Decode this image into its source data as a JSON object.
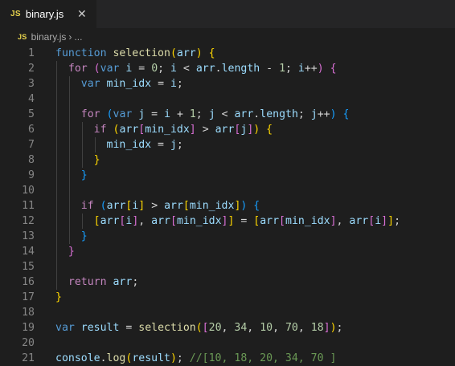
{
  "tab": {
    "icon": "JS",
    "filename": "binary.js",
    "close": "✕"
  },
  "breadcrumb": {
    "icon": "JS",
    "file": "binary.js",
    "separator": "›",
    "more": "..."
  },
  "lines": [
    {
      "n": "1",
      "indent": 0,
      "tokens": [
        [
          "function",
          "kw"
        ],
        [
          " ",
          "op"
        ],
        [
          "selection",
          "fn"
        ],
        [
          "(",
          "b1"
        ],
        [
          "arr",
          "var"
        ],
        [
          ")",
          "b1"
        ],
        [
          " ",
          "op"
        ],
        [
          "{",
          "b1"
        ]
      ]
    },
    {
      "n": "2",
      "indent": 1,
      "tokens": [
        [
          "for",
          "kwc"
        ],
        [
          " ",
          "op"
        ],
        [
          "(",
          "b2"
        ],
        [
          "var",
          "kw"
        ],
        [
          " ",
          "op"
        ],
        [
          "i",
          "var"
        ],
        [
          " = ",
          "op"
        ],
        [
          "0",
          "num"
        ],
        [
          "; ",
          "op"
        ],
        [
          "i",
          "var"
        ],
        [
          " < ",
          "op"
        ],
        [
          "arr",
          "var"
        ],
        [
          ".",
          "op"
        ],
        [
          "length",
          "var"
        ],
        [
          " - ",
          "op"
        ],
        [
          "1",
          "num"
        ],
        [
          "; ",
          "op"
        ],
        [
          "i",
          "var"
        ],
        [
          "++",
          "op"
        ],
        [
          ")",
          "b2"
        ],
        [
          " ",
          "op"
        ],
        [
          "{",
          "b2"
        ]
      ]
    },
    {
      "n": "3",
      "indent": 2,
      "tokens": [
        [
          "var",
          "kw"
        ],
        [
          " ",
          "op"
        ],
        [
          "min_idx",
          "var"
        ],
        [
          " = ",
          "op"
        ],
        [
          "i",
          "var"
        ],
        [
          ";",
          "op"
        ]
      ]
    },
    {
      "n": "4",
      "indent": 2,
      "tokens": []
    },
    {
      "n": "5",
      "indent": 2,
      "tokens": [
        [
          "for",
          "kwc"
        ],
        [
          " ",
          "op"
        ],
        [
          "(",
          "b3"
        ],
        [
          "var",
          "kw"
        ],
        [
          " ",
          "op"
        ],
        [
          "j",
          "var"
        ],
        [
          " = ",
          "op"
        ],
        [
          "i",
          "var"
        ],
        [
          " + ",
          "op"
        ],
        [
          "1",
          "num"
        ],
        [
          "; ",
          "op"
        ],
        [
          "j",
          "var"
        ],
        [
          " < ",
          "op"
        ],
        [
          "arr",
          "var"
        ],
        [
          ".",
          "op"
        ],
        [
          "length",
          "var"
        ],
        [
          "; ",
          "op"
        ],
        [
          "j",
          "var"
        ],
        [
          "++",
          "op"
        ],
        [
          ")",
          "b3"
        ],
        [
          " ",
          "op"
        ],
        [
          "{",
          "b3"
        ]
      ]
    },
    {
      "n": "6",
      "indent": 3,
      "tokens": [
        [
          "if",
          "kwc"
        ],
        [
          " ",
          "op"
        ],
        [
          "(",
          "b1"
        ],
        [
          "arr",
          "var"
        ],
        [
          "[",
          "b2"
        ],
        [
          "min_idx",
          "var"
        ],
        [
          "]",
          "b2"
        ],
        [
          " > ",
          "op"
        ],
        [
          "arr",
          "var"
        ],
        [
          "[",
          "b2"
        ],
        [
          "j",
          "var"
        ],
        [
          "]",
          "b2"
        ],
        [
          ")",
          "b1"
        ],
        [
          " ",
          "op"
        ],
        [
          "{",
          "b1"
        ]
      ]
    },
    {
      "n": "7",
      "indent": 4,
      "tokens": [
        [
          "min_idx",
          "var"
        ],
        [
          " = ",
          "op"
        ],
        [
          "j",
          "var"
        ],
        [
          ";",
          "op"
        ]
      ]
    },
    {
      "n": "8",
      "indent": 3,
      "tokens": [
        [
          "}",
          "b1"
        ]
      ]
    },
    {
      "n": "9",
      "indent": 2,
      "tokens": [
        [
          "}",
          "b3"
        ]
      ]
    },
    {
      "n": "10",
      "indent": 2,
      "tokens": []
    },
    {
      "n": "11",
      "indent": 2,
      "tokens": [
        [
          "if",
          "kwc"
        ],
        [
          " ",
          "op"
        ],
        [
          "(",
          "b3"
        ],
        [
          "arr",
          "var"
        ],
        [
          "[",
          "b1"
        ],
        [
          "i",
          "var"
        ],
        [
          "]",
          "b1"
        ],
        [
          " > ",
          "op"
        ],
        [
          "arr",
          "var"
        ],
        [
          "[",
          "b1"
        ],
        [
          "min_idx",
          "var"
        ],
        [
          "]",
          "b1"
        ],
        [
          ")",
          "b3"
        ],
        [
          " ",
          "op"
        ],
        [
          "{",
          "b3"
        ]
      ]
    },
    {
      "n": "12",
      "indent": 3,
      "tokens": [
        [
          "[",
          "b1"
        ],
        [
          "arr",
          "var"
        ],
        [
          "[",
          "b2"
        ],
        [
          "i",
          "var"
        ],
        [
          "]",
          "b2"
        ],
        [
          ", ",
          "op"
        ],
        [
          "arr",
          "var"
        ],
        [
          "[",
          "b2"
        ],
        [
          "min_idx",
          "var"
        ],
        [
          "]",
          "b2"
        ],
        [
          "]",
          "b1"
        ],
        [
          " = ",
          "op"
        ],
        [
          "[",
          "b1"
        ],
        [
          "arr",
          "var"
        ],
        [
          "[",
          "b2"
        ],
        [
          "min_idx",
          "var"
        ],
        [
          "]",
          "b2"
        ],
        [
          ", ",
          "op"
        ],
        [
          "arr",
          "var"
        ],
        [
          "[",
          "b2"
        ],
        [
          "i",
          "var"
        ],
        [
          "]",
          "b2"
        ],
        [
          "]",
          "b1"
        ],
        [
          ";",
          "op"
        ]
      ]
    },
    {
      "n": "13",
      "indent": 2,
      "tokens": [
        [
          "}",
          "b3"
        ]
      ]
    },
    {
      "n": "14",
      "indent": 1,
      "tokens": [
        [
          "}",
          "b2"
        ]
      ]
    },
    {
      "n": "15",
      "indent": 1,
      "tokens": []
    },
    {
      "n": "16",
      "indent": 1,
      "tokens": [
        [
          "return",
          "kwc"
        ],
        [
          " ",
          "op"
        ],
        [
          "arr",
          "var"
        ],
        [
          ";",
          "op"
        ]
      ]
    },
    {
      "n": "17",
      "indent": 0,
      "tokens": [
        [
          "}",
          "b1"
        ]
      ]
    },
    {
      "n": "18",
      "indent": 0,
      "tokens": []
    },
    {
      "n": "19",
      "indent": 0,
      "tokens": [
        [
          "var",
          "kw"
        ],
        [
          " ",
          "op"
        ],
        [
          "result",
          "var"
        ],
        [
          " = ",
          "op"
        ],
        [
          "selection",
          "fn"
        ],
        [
          "(",
          "b1"
        ],
        [
          "[",
          "b2"
        ],
        [
          "20",
          "num"
        ],
        [
          ", ",
          "op"
        ],
        [
          "34",
          "num"
        ],
        [
          ", ",
          "op"
        ],
        [
          "10",
          "num"
        ],
        [
          ", ",
          "op"
        ],
        [
          "70",
          "num"
        ],
        [
          ", ",
          "op"
        ],
        [
          "18",
          "num"
        ],
        [
          "]",
          "b2"
        ],
        [
          ")",
          "b1"
        ],
        [
          ";",
          "op"
        ]
      ]
    },
    {
      "n": "20",
      "indent": 0,
      "tokens": []
    },
    {
      "n": "21",
      "indent": 0,
      "tokens": [
        [
          "console",
          "var"
        ],
        [
          ".",
          "op"
        ],
        [
          "log",
          "fn"
        ],
        [
          "(",
          "b1"
        ],
        [
          "result",
          "var"
        ],
        [
          ")",
          "b1"
        ],
        [
          "; ",
          "op"
        ],
        [
          "//[10, 18, 20, 34, 70 ]",
          "cm"
        ]
      ]
    }
  ]
}
